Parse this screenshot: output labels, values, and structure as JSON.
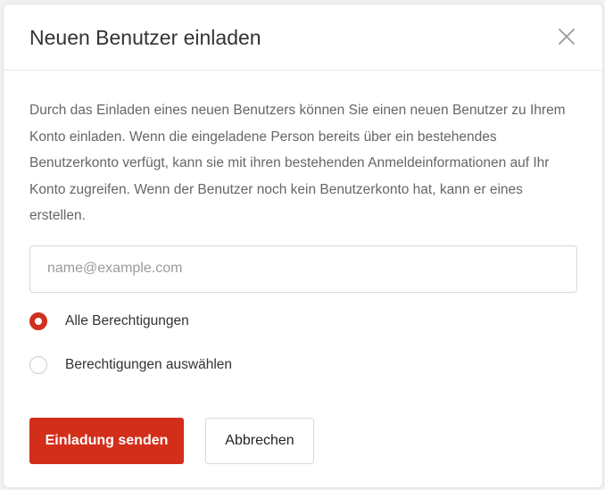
{
  "dialog": {
    "title": "Neuen Benutzer einladen",
    "close_icon": "close-icon",
    "description": "Durch das Einladen eines neuen Benutzers können Sie einen neuen Benutzer zu Ihrem Konto einladen. Wenn die eingeladene Person bereits über ein bestehendes Benutzerkonto verfügt, kann sie mit ihren bestehenden Anmeldeinformationen auf Ihr Konto zugreifen. Wenn der Benutzer noch kein Benutzerkonto hat, kann er eines erstellen.",
    "email": {
      "value": "",
      "placeholder": "name@example.com"
    },
    "permissions": {
      "selected": "all",
      "options": [
        {
          "id": "all",
          "label": "Alle Berechtigungen"
        },
        {
          "id": "select",
          "label": "Berechtigungen auswählen"
        }
      ]
    },
    "buttons": {
      "send_label": "Einladung senden",
      "cancel_label": "Abbrechen"
    }
  },
  "colors": {
    "accent": "#d22e1a",
    "text_primary": "#333333",
    "text_secondary": "#666666",
    "border": "#d8d8d8"
  }
}
